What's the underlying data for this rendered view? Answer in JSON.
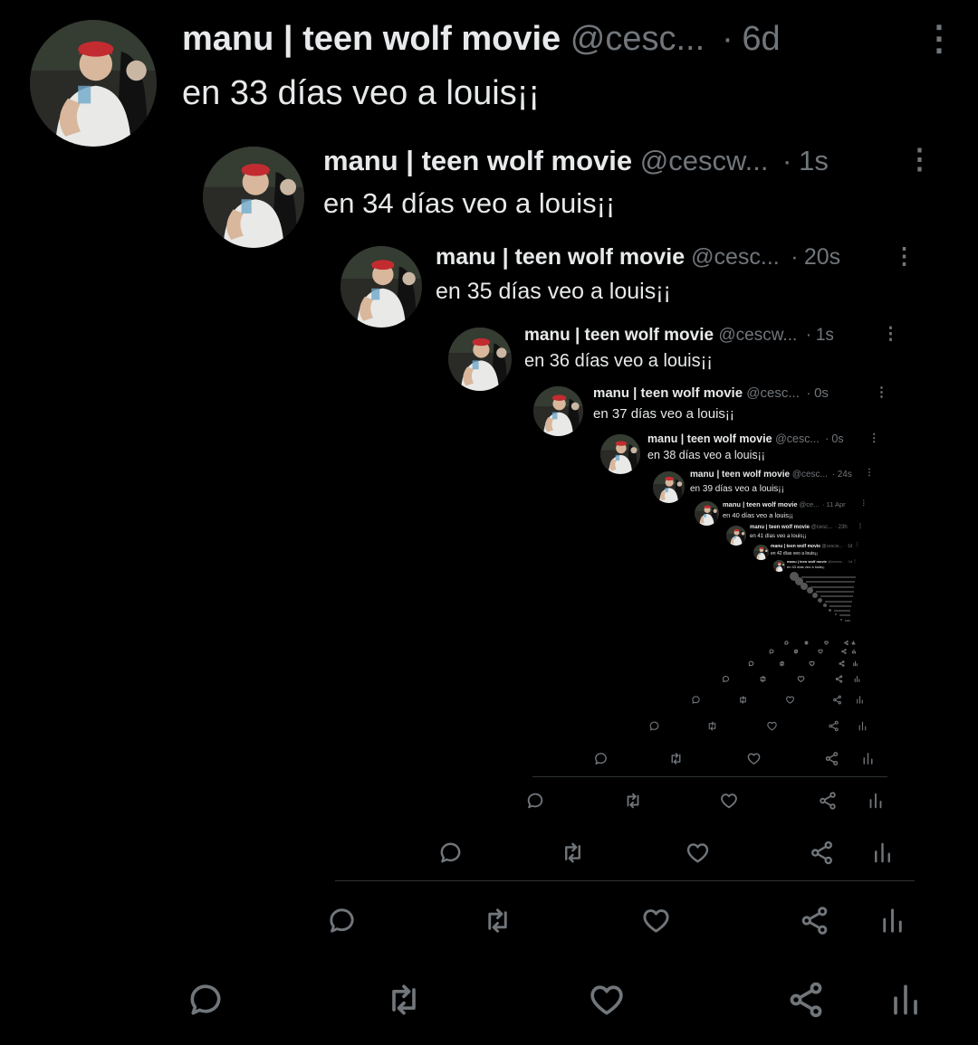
{
  "tweets": [
    {
      "name": "manu | teen wolf movie",
      "handle": "@cesc...",
      "time": "6d",
      "text": "en 33 días veo a louis¡¡"
    },
    {
      "name": "manu | teen wolf movie",
      "handle": "@cescw...",
      "time": "1s",
      "text": "en 34 días veo a louis¡¡"
    },
    {
      "name": "manu | teen wolf movie",
      "handle": "@cesc...",
      "time": "20s",
      "text": "en 35 días veo a louis¡¡"
    },
    {
      "name": "manu | teen wolf movie",
      "handle": "@cescw...",
      "time": "1s",
      "text": "en 36 días veo a louis¡¡"
    },
    {
      "name": "manu | teen wolf movie",
      "handle": "@cesc...",
      "time": "0s",
      "text": "en 37 días veo a louis¡¡"
    },
    {
      "name": "manu | teen wolf movie",
      "handle": "@cesc...",
      "time": "0s",
      "text": "en 38 días veo a louis¡¡"
    },
    {
      "name": "manu | teen wolf movie",
      "handle": "@cesc...",
      "time": "24s",
      "text": "en 39 días veo a louis¡¡"
    },
    {
      "name": "manu | teen wolf movie",
      "handle": "@ce...",
      "time": "11 Apr",
      "text": "en 40 días veo a louis¡¡"
    },
    {
      "name": "manu | teen wolf movie",
      "handle": "@cesc...",
      "time": "23h",
      "text": "en 41 días veo a louis¡¡"
    },
    {
      "name": "manu | teen wolf movie",
      "handle": "@cescw...",
      "time": "1d",
      "text": "en 42 días veo a louis¡¡"
    },
    {
      "name": "manu | teen wolf movie",
      "handle": "@cescw...",
      "time": "1d",
      "text": "en 43 días veo a louis¡¡"
    }
  ],
  "icons": {
    "reply": "reply-icon",
    "retweet": "retweet-icon",
    "like": "like-icon",
    "share": "share-icon",
    "views": "views-icon",
    "more": "more-vertical-icon"
  },
  "colors": {
    "background": "#000000",
    "text_primary": "#e7e9ea",
    "text_secondary": "#71767b",
    "divider": "#2f3336"
  },
  "more_glyph": "⋮",
  "dot_glyph": "·"
}
